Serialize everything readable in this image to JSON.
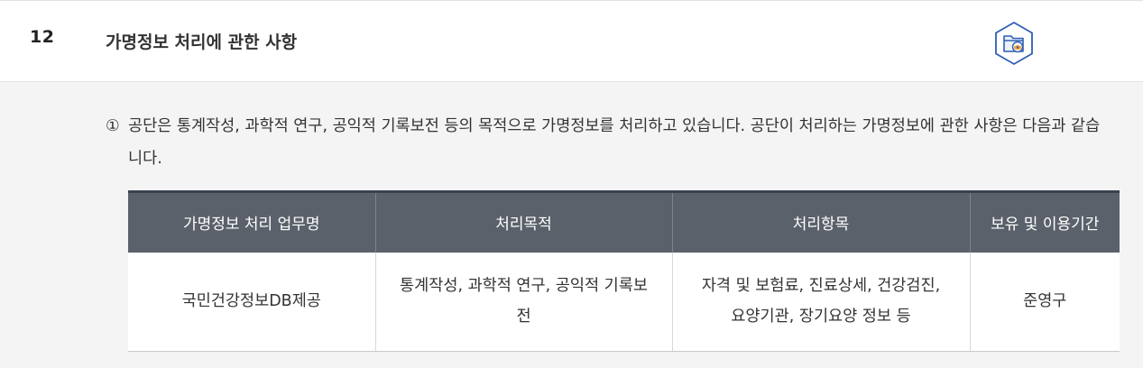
{
  "section": {
    "number": "12",
    "title": "가명정보 처리에 관한 사항",
    "icon": "pseudonymized-info-folder-icon"
  },
  "intro": {
    "marker": "①",
    "text": "공단은 통계작성, 과학적 연구, 공익적 기록보전 등의 목적으로 가명정보를 처리하고 있습니다. 공단이 처리하는 가명정보에 관한 사항은 다음과 같습니다."
  },
  "table": {
    "headers": [
      "가명정보 처리 업무명",
      "처리목적",
      "처리항목",
      "보유 및 이용기간"
    ],
    "rows": [
      [
        "국민건강정보DB제공",
        "통계작성, 과학적 연구, 공익적 기록보전",
        "자격 및 보험료, 진료상세, 건강검진, 요양기관, 장기요양 정보 등",
        "준영구"
      ]
    ]
  },
  "colors": {
    "header_bg": "#5b616b",
    "header_top_border": "#3b4250",
    "body_bg": "#f4f4f4",
    "icon_accent": "#2f5fb3",
    "icon_highlight": "#f2a33a"
  }
}
